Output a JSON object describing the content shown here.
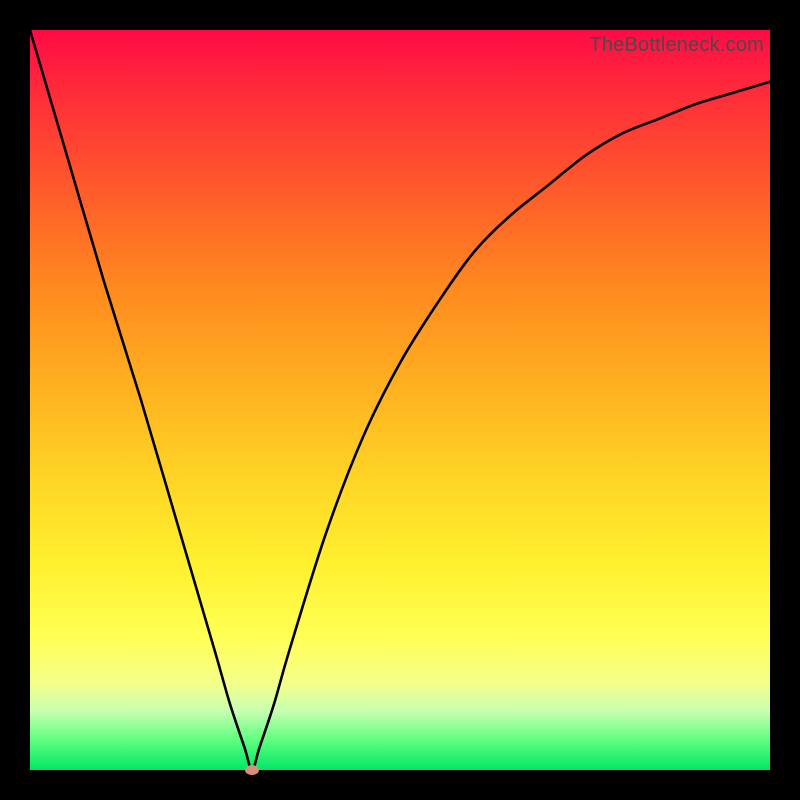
{
  "watermark": "TheBottleneck.com",
  "chart_data": {
    "type": "line",
    "title": "",
    "xlabel": "",
    "ylabel": "",
    "xlim": [
      0,
      100
    ],
    "ylim": [
      0,
      100
    ],
    "x": [
      0,
      5,
      10,
      15,
      20,
      25,
      27,
      29,
      30,
      31,
      33,
      35,
      40,
      45,
      50,
      55,
      60,
      65,
      70,
      75,
      80,
      85,
      90,
      95,
      100
    ],
    "values": [
      100,
      83,
      66,
      50,
      33,
      16,
      9,
      3,
      0,
      3,
      9,
      16,
      32,
      45,
      55,
      63,
      70,
      75,
      79,
      83,
      86,
      88,
      90,
      91.5,
      93
    ],
    "grid": false,
    "legend": false,
    "marker": {
      "x": 30,
      "y": 0,
      "color": "#d98f7a"
    },
    "background_gradient": {
      "top": "#ff0b46",
      "bottom": "#00e765"
    }
  }
}
